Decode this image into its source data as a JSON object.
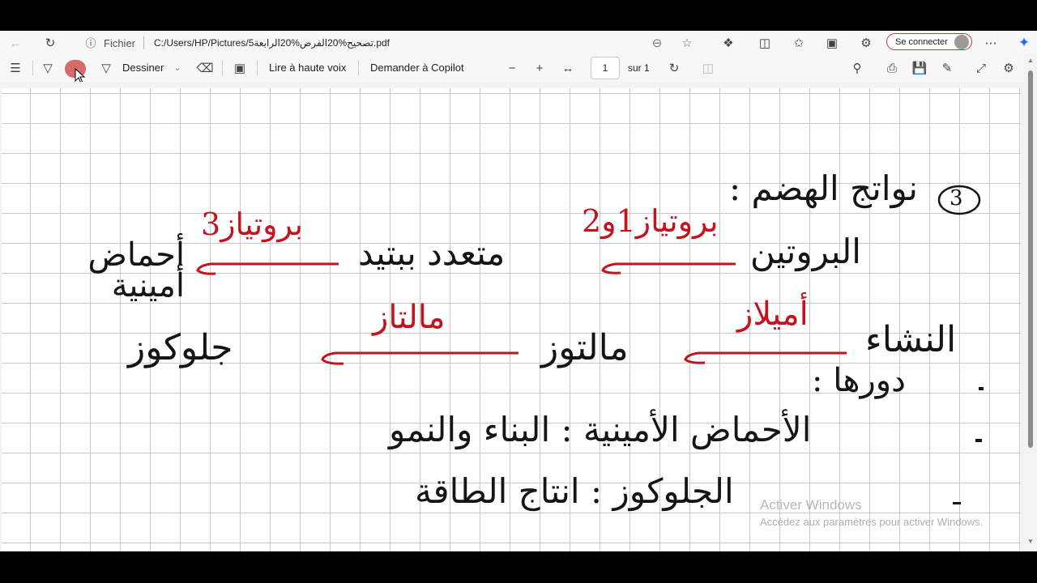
{
  "browser": {
    "site_info_label": "Fichier",
    "url": "C:/Users/HP/Pictures/5تصحيح%20الفرض%20الرابعة.pdf",
    "signin_label": "Se connecter"
  },
  "pdf_toolbar": {
    "draw_label": "Dessiner",
    "read_aloud_label": "Lire à haute voix",
    "copilot_label": "Demander à Copilot",
    "page_current": "1",
    "page_total": "sur 1"
  },
  "document": {
    "question_number": "3",
    "heading": "نواتج الهضم :",
    "row1": {
      "start": "البروتين",
      "enzyme1": "بروتياز1و2",
      "middle": "متعدد ببتيد",
      "enzyme2": "بروتياز3",
      "end": "أحماض أمينية"
    },
    "row2": {
      "start": "النشاء",
      "enzyme1": "أميلاز",
      "middle": "مالتوز",
      "enzyme2": "مالتاز",
      "end": "جلوكوز"
    },
    "role_heading": "دورها :",
    "role1": "الأحماض الأمينية : البناء والنمو",
    "role2": "الجلوكوز : انتاج الطاقة"
  },
  "watermark": {
    "line1": "Activer Windows",
    "line2": "Accédez aux paramètres pour activer Windows."
  }
}
